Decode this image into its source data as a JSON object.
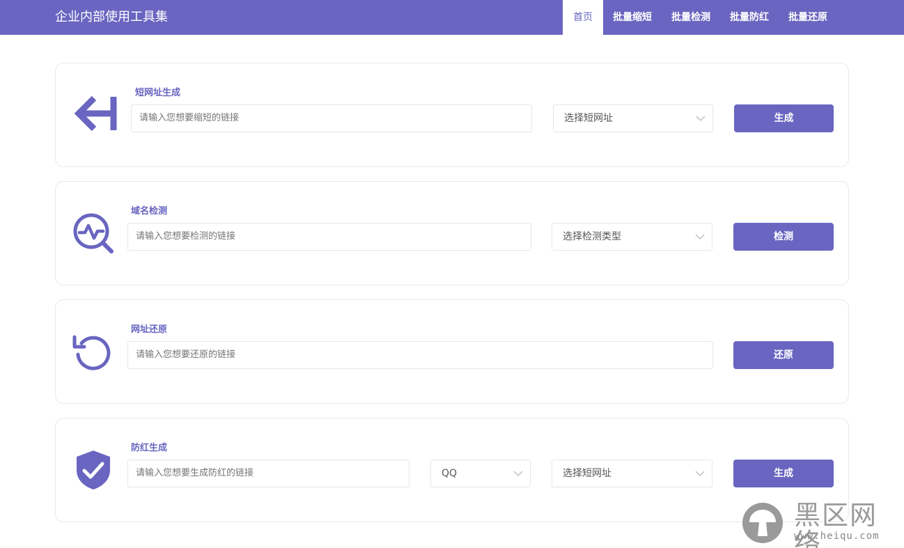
{
  "header": {
    "brand": "企业内部使用工具集",
    "nav": [
      {
        "label": "首页",
        "active": true
      },
      {
        "label": "批量缩短"
      },
      {
        "label": "批量检测"
      },
      {
        "label": "批量防红"
      },
      {
        "label": "批量还原"
      }
    ]
  },
  "cards": [
    {
      "title": "短网址生成",
      "icon": "arrow-left-bar-icon",
      "input_placeholder": "请输入您想要缩短的链接",
      "select_value": "选择短网址",
      "button": "生成"
    },
    {
      "title": "域名检测",
      "icon": "pulse-search-icon",
      "input_placeholder": "请输入您想要检测的链接",
      "select_value": "选择检测类型",
      "button": "检测"
    },
    {
      "title": "网址还原",
      "icon": "undo-circle-icon",
      "input_placeholder": "请输入您想要还原的链接",
      "button": "还原"
    },
    {
      "title": "防红生成",
      "icon": "shield-check-icon",
      "input_placeholder": "请输入您想要生成防红的链接",
      "select_app": "QQ",
      "select_value": "选择短网址",
      "button": "生成"
    }
  ],
  "watermark": {
    "text": "黑区网络",
    "url": "www.heiqu.com"
  },
  "colors": {
    "accent": "#6965c0",
    "border": "#e9e9ef"
  }
}
